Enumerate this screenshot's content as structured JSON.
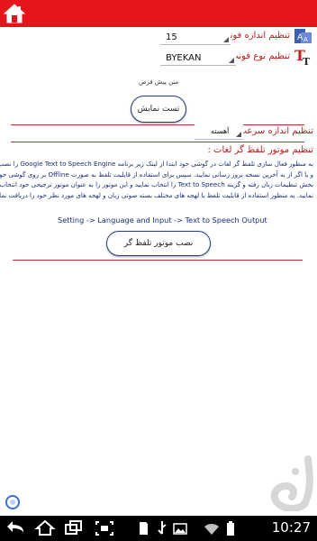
{
  "settings": {
    "font_size": {
      "label": "تنظیم اندازه فونت :",
      "value": "15"
    },
    "font_type": {
      "label": "تنظیم نوع فونت :",
      "value": "BYEKAN"
    },
    "sample_text": "متن پیش فرض",
    "test_button": "تست نمایش",
    "speech_rate": {
      "label": "تنظیم اندازه سرعت تلفظ:",
      "value": "آهسته"
    },
    "tts_engine": {
      "label": "تنظیم موتور تلفظ گر لغات :",
      "description_lines": [
        "به منظور فعال سازی تلفظ گر لغات در گوشی خود ابتدا از لینک زیر برنامه Google Text to Speech Engine را نصب",
        "و یا اگر از به آخرین نسخه بروز رسانی نمایید. سپس برای استفاده از قابلیت تلفظ به صورت Offline بر روی گوشی خود به",
        "بخش تنظیمات زبان رفته و گزینه Text to Speech را انتخاب نمایید و این موتور را به عنوان موتور ترجیحی خود انتخاب",
        "نمایید. به منظور استفاده از قابلیت تلفظ با لهجه های مختلف بسته صوتی زبان و لهجه های مورد نظر خود را دریافت نمایید."
      ],
      "settings_path": "Setting -> Language and Input -> Text to Speech Output",
      "install_button": "نصب موتور تلفظ گر"
    }
  },
  "status_bar": {
    "time": "10:27"
  },
  "icons": {
    "home": "home-icon",
    "font_size": "font-size-icon",
    "font_type": "font-type-icon",
    "back": "back-icon",
    "home_nav": "home-nav-icon",
    "recent": "recent-apps-icon",
    "screenshot": "screenshot-icon",
    "sd_card": "sd-card-icon",
    "usb": "usb-icon",
    "image": "image-icon",
    "wifi": "wifi-icon",
    "battery": "battery-icon"
  },
  "colors": {
    "header": "#e8141d",
    "label": "#b52020",
    "body_text": "#1a2d7c",
    "button_border": "#233f7b"
  }
}
